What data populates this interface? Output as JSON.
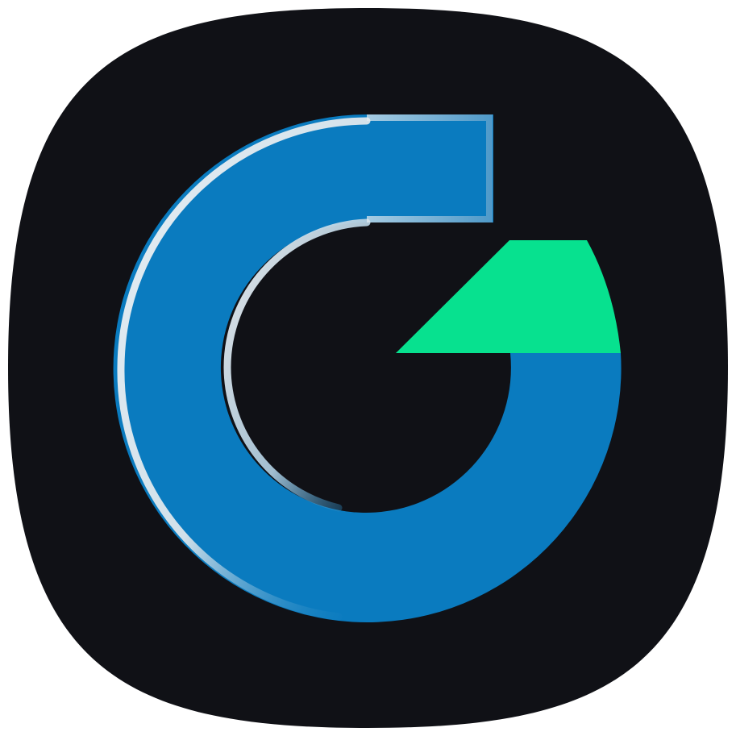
{
  "app_icon": {
    "name": "app-icon",
    "shape": "squircle",
    "colors": {
      "background": "#101116",
      "ring_blue": "#0A7BBF",
      "ring_highlight": "#E6EEF2",
      "accent_green": "#07E18F"
    },
    "glyph": "G"
  }
}
